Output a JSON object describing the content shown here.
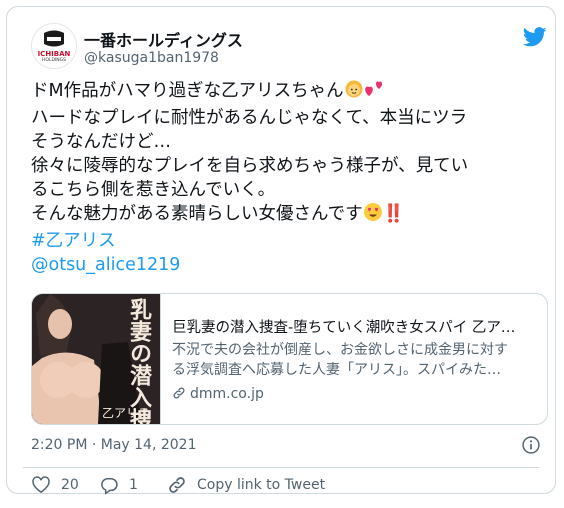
{
  "author": {
    "display_name": "一番ホールディングス",
    "handle": "@kasuga1ban1978",
    "avatar_text_top": "ICHIBAN",
    "avatar_text_bottom": "HOLDINGS"
  },
  "tweet": {
    "line1": "ドM作品がハマり過ぎな乙アリスちゃん",
    "line2": "ハードなプレイに耐性があるんじゃなくて、本当にツラ",
    "line3": "そうなんだけど…",
    "line4": "徐々に陵辱的なプレイを自ら求めちゃう様子が、見てい",
    "line5": "るこちら側を惹き込んでいく。",
    "line6": "そんな魅力がある素晴らしい女優さんです",
    "line6_suffix": "‼️",
    "hashtag": "#乙アリス",
    "mention": "@otsu_alice1219"
  },
  "link_card": {
    "title": "巨乳妻の潜入捜査-堕ちていく潮吹き女スパイ 乙ア…",
    "desc_line1": "不況で夫の会社が倒産し、お金欲しさに成金男に対す",
    "desc_line2": "る浮気調査へ応募した人妻「アリス」。スパイみた…",
    "domain": "dmm.co.jp",
    "thumb_text": "乳妻の潜入捜",
    "thumb_caption": "乙アリス"
  },
  "meta": {
    "timestamp": "2:20 PM · May 14, 2021"
  },
  "actions": {
    "likes": "20",
    "replies": "1",
    "copy_link": "Copy link to Tweet"
  },
  "colors": {
    "link": "#1d9bf0",
    "like": "#536471"
  }
}
